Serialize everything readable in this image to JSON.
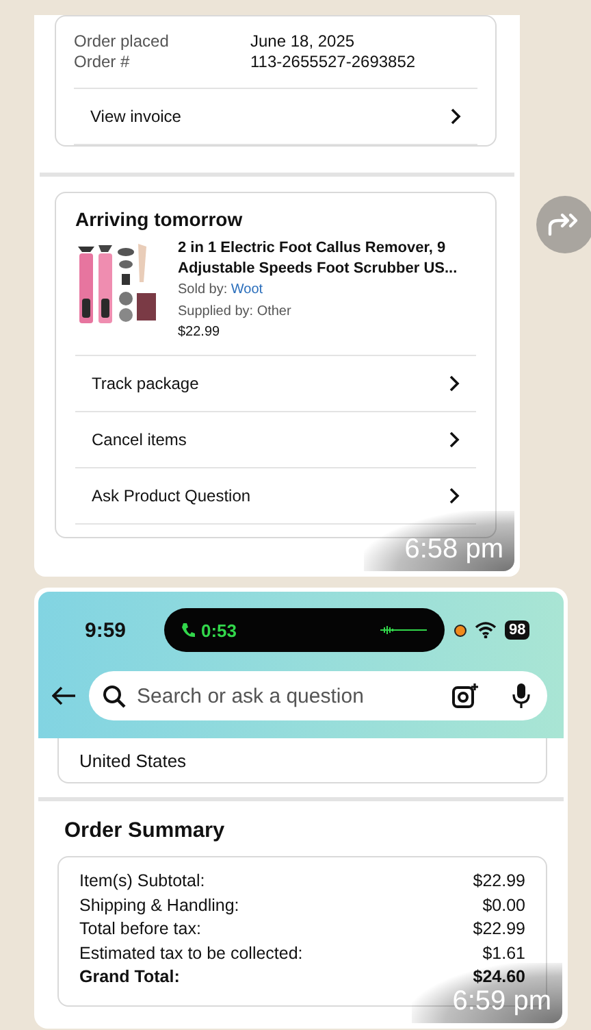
{
  "messages": [
    {
      "kind": "order_details",
      "time": "6:58 pm",
      "order_info": [
        {
          "label": "Order placed",
          "value": "June 18, 2025"
        },
        {
          "label": "Order #",
          "value": "113-2655527-2693852"
        }
      ],
      "invoice_link": "View invoice",
      "shipment": {
        "title": "Arriving tomorrow",
        "product": {
          "title": "2 in 1 Electric Foot Callus Remover, 9 Adjustable Speeds Foot Scrubber US...",
          "sold_by_label": "Sold by:",
          "seller": "Woot",
          "supplied_by": "Supplied by: Other",
          "price": "$22.99"
        },
        "actions": [
          "Track package",
          "Cancel items",
          "Ask Product Question"
        ]
      }
    },
    {
      "kind": "order_summary",
      "time": "6:59 pm",
      "status_bar": {
        "time": "9:59",
        "call_timer": "0:53",
        "battery": "98"
      },
      "search": {
        "placeholder": "Search or ask a question"
      },
      "address_tail": "United States",
      "summary": {
        "title": "Order Summary",
        "rows": [
          {
            "kind": "line",
            "label": "Item(s) Subtotal:",
            "amount": "$22.99"
          },
          {
            "kind": "line",
            "label": "Shipping & Handling:",
            "amount": "$0.00"
          },
          {
            "kind": "line",
            "label": "Total before tax:",
            "amount": "$22.99"
          },
          {
            "kind": "line",
            "label": "Estimated tax to be collected:",
            "amount": "$1.61"
          },
          {
            "kind": "total",
            "label": "Grand Total:",
            "amount": "$24.60"
          }
        ]
      }
    }
  ]
}
